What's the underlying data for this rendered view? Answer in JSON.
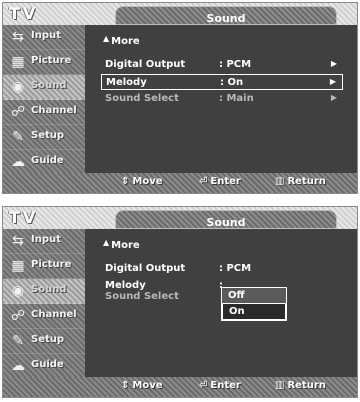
{
  "header": {
    "tv_label": "TV",
    "title": "Sound"
  },
  "sidebar": {
    "items": [
      {
        "label": "Input",
        "icon": "input-icon"
      },
      {
        "label": "Picture",
        "icon": "picture-icon"
      },
      {
        "label": "Sound",
        "icon": "sound-icon",
        "active": true
      },
      {
        "label": "Channel",
        "icon": "channel-icon"
      },
      {
        "label": "Setup",
        "icon": "setup-icon"
      },
      {
        "label": "Guide",
        "icon": "guide-icon"
      }
    ]
  },
  "menu": {
    "more": "More",
    "rows": [
      {
        "name": "Digital Output",
        "value": ": PCM"
      },
      {
        "name": "Melody",
        "value": ": On"
      },
      {
        "name": "Sound Select",
        "value": ": Main"
      }
    ]
  },
  "screen2": {
    "rows": [
      {
        "name": "Digital Output",
        "value": ": PCM"
      },
      {
        "name": "Melody",
        "value": ":"
      },
      {
        "name": "Sound Select"
      }
    ],
    "dropdown": {
      "options": [
        "Off",
        "On"
      ],
      "selected": "On"
    }
  },
  "footer": {
    "move": "Move",
    "enter": "Enter",
    "return": "Return"
  }
}
